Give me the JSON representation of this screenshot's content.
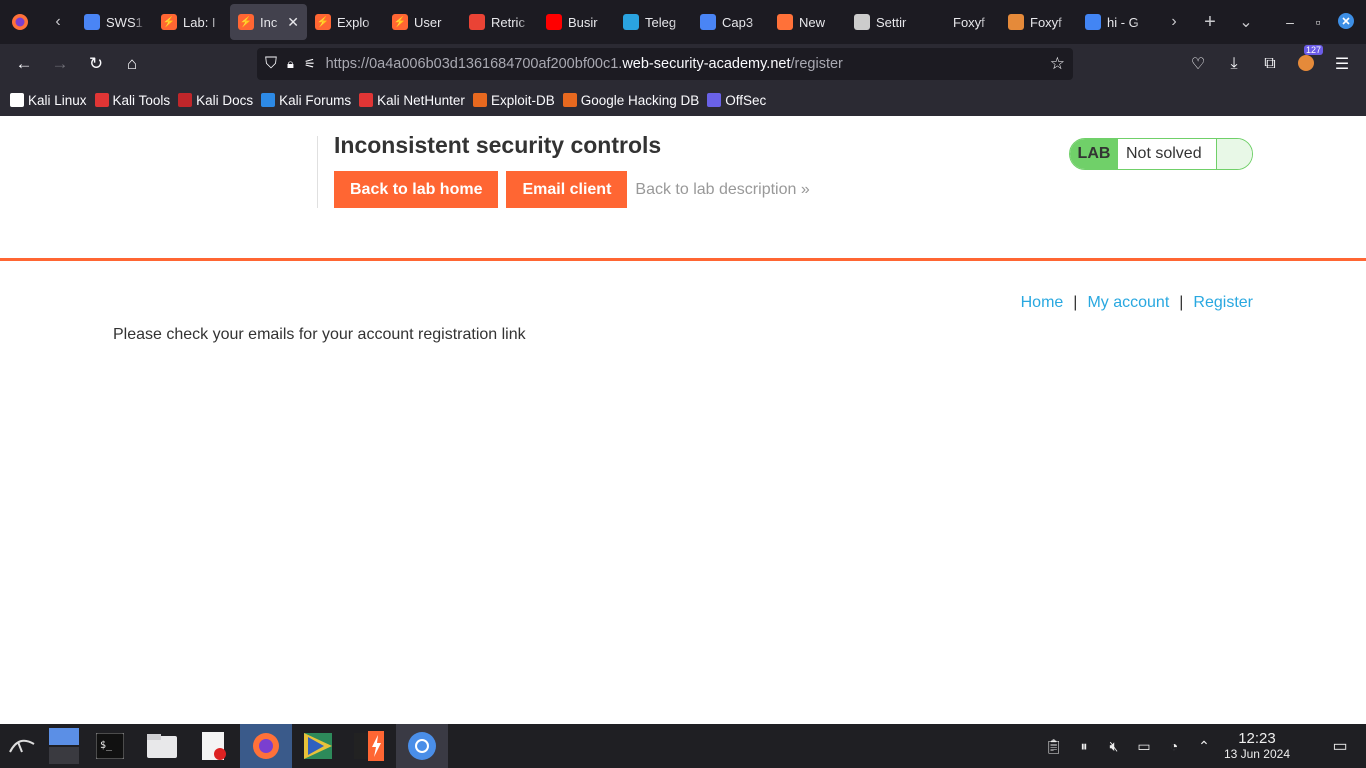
{
  "browser": {
    "tabs": [
      {
        "label": "SWS1",
        "icon": "docs-icon",
        "color": "#4a85f5"
      },
      {
        "label": "Lab: I",
        "icon": "portswigger-icon",
        "color": "#ff6633"
      },
      {
        "label": "Inc",
        "icon": "portswigger-icon",
        "color": "#ff6633",
        "active": true
      },
      {
        "label": "Explo",
        "icon": "portswigger-icon",
        "color": "#ff6633"
      },
      {
        "label": "User",
        "icon": "portswigger-icon",
        "color": "#ff6633"
      },
      {
        "label": "Retric",
        "icon": "gmail-icon",
        "color": "#ea4335"
      },
      {
        "label": "Busir",
        "icon": "youtube-icon",
        "color": "#ff0000"
      },
      {
        "label": "Teleg",
        "icon": "telegram-icon",
        "color": "#2aa3e0"
      },
      {
        "label": "Cap3",
        "icon": "docs-icon",
        "color": "#4a85f5"
      },
      {
        "label": "New",
        "icon": "firefox-icon",
        "color": "#ff7139"
      },
      {
        "label": "Settir",
        "icon": "gear-icon",
        "color": "#cccccc"
      },
      {
        "label": "Foxyf",
        "icon": "none",
        "color": "#1c1b22"
      },
      {
        "label": "Foxyf",
        "icon": "foxyproxy-icon",
        "color": "#e58a3a"
      },
      {
        "label": "hi - G",
        "icon": "google-icon",
        "color": "#4285f4"
      }
    ],
    "url_prefix": "https://0a4a006b03d1361684700af200bf00c1.",
    "url_domain": "web-security-academy.net",
    "url_path": "/register",
    "extension_badge": "127",
    "bookmarks": [
      {
        "label": "Kali Linux",
        "color": "#ffffff"
      },
      {
        "label": "Kali Tools",
        "color": "#e03535"
      },
      {
        "label": "Kali Docs",
        "color": "#c0262a"
      },
      {
        "label": "Kali Forums",
        "color": "#2d8ae6"
      },
      {
        "label": "Kali NetHunter",
        "color": "#e03535"
      },
      {
        "label": "Exploit-DB",
        "color": "#e8691f"
      },
      {
        "label": "Google Hacking DB",
        "color": "#e8691f"
      },
      {
        "label": "OffSec",
        "color": "#6a62e8"
      }
    ]
  },
  "page": {
    "lab_title": "Inconsistent security controls",
    "back_home": "Back to lab home",
    "email_client": "Email client",
    "back_desc": "Back to lab description",
    "lab_badge": "LAB",
    "lab_status": "Not solved",
    "nav": {
      "home": "Home",
      "sep1": "|",
      "my_account": "My account",
      "sep2": "|",
      "register": "Register"
    },
    "message": "Please check your emails for your account registration link"
  },
  "taskbar": {
    "time": "12:23",
    "date": "13 Jun 2024"
  }
}
